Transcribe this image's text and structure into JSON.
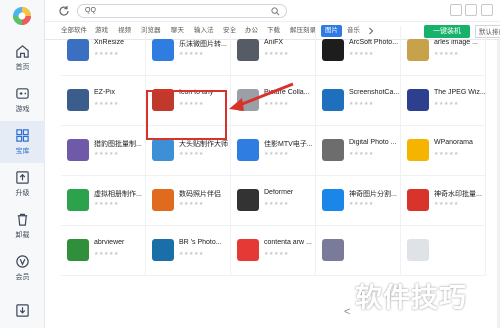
{
  "search": {
    "value": "QQ"
  },
  "sidebar": {
    "items": [
      {
        "label": "首页",
        "icon": "home-icon"
      },
      {
        "label": "游戏",
        "icon": "gamepad-icon"
      },
      {
        "label": "宝库",
        "icon": "grid-apps-icon",
        "active": true
      },
      {
        "label": "升级",
        "icon": "upgrade-icon"
      },
      {
        "label": "卸载",
        "icon": "trash-icon"
      },
      {
        "label": "会员",
        "icon": "vip-icon"
      },
      {
        "label": "",
        "icon": "download-icon"
      }
    ]
  },
  "categories": [
    {
      "label": "全部软件"
    },
    {
      "label": "游戏"
    },
    {
      "label": "视频"
    },
    {
      "label": "浏览器"
    },
    {
      "label": "聊天"
    },
    {
      "label": "输入法"
    },
    {
      "label": "安全"
    },
    {
      "label": "办公"
    },
    {
      "label": "下载"
    },
    {
      "label": "解压刻录"
    },
    {
      "label": "图片",
      "active": true
    },
    {
      "label": "音乐"
    }
  ],
  "toolbar": {
    "onekey_label": "一键装机",
    "sort_label": "默认排序"
  },
  "apps": [
    {
      "name": "XnResize",
      "icon_color": "#3b6fc2"
    },
    {
      "name": "乐沫微图片转...",
      "icon_color": "#2f7de1"
    },
    {
      "name": "AniFX",
      "icon_color": "#555c66"
    },
    {
      "name": "ArcSoft Photo...",
      "icon_color": "#1d1d1d"
    },
    {
      "name": "arles image ...",
      "icon_color": "#c8a24a"
    },
    {
      "name": "EZ-Pix",
      "icon_color": "#3a5d8c"
    },
    {
      "name": "Icon to any",
      "icon_color": "#c0392b"
    },
    {
      "name": "Picture Colla...",
      "icon_color": "#9aa0a6"
    },
    {
      "name": "ScreenshotCa...",
      "icon_color": "#1f6fbf"
    },
    {
      "name": "The JPEG Wiz...",
      "icon_color": "#2d3f8f"
    },
    {
      "name": "猎豹图批量制...",
      "icon_color": "#6e5aa8"
    },
    {
      "name": "大头贴制作大师",
      "icon_color": "#3d8fd6"
    },
    {
      "name": "佳影MTV电子...",
      "icon_color": "#2f7de1"
    },
    {
      "name": "Digital Photo ...",
      "icon_color": "#6d6d6d"
    },
    {
      "name": "WPanorama",
      "icon_color": "#f4b400"
    },
    {
      "name": "虚拟相册制作...",
      "icon_color": "#2ca24c"
    },
    {
      "name": "数码照片伴侣",
      "icon_color": "#e06b1f"
    },
    {
      "name": "Deformer",
      "icon_color": "#333333"
    },
    {
      "name": "神奇图片分割...",
      "icon_color": "#1a86e8"
    },
    {
      "name": "神奇水印批量...",
      "icon_color": "#d9342b"
    },
    {
      "name": "abrviewer",
      "icon_color": "#2f8f3a"
    },
    {
      "name": "BR 's Photo...",
      "icon_color": "#1a6fa8"
    },
    {
      "name": "contenta arw ...",
      "icon_color": "#e53935"
    },
    {
      "name": "",
      "icon_color": "#7a7a9a"
    },
    {
      "name": "",
      "icon_color": "#dfe3e8"
    }
  ],
  "stars": "★★★★★",
  "watermark": "软件技巧",
  "pager": {
    "prev": "<"
  },
  "colors": {
    "accent": "#2e7be6",
    "install": "#17b26a",
    "highlight": "#d8322b"
  }
}
